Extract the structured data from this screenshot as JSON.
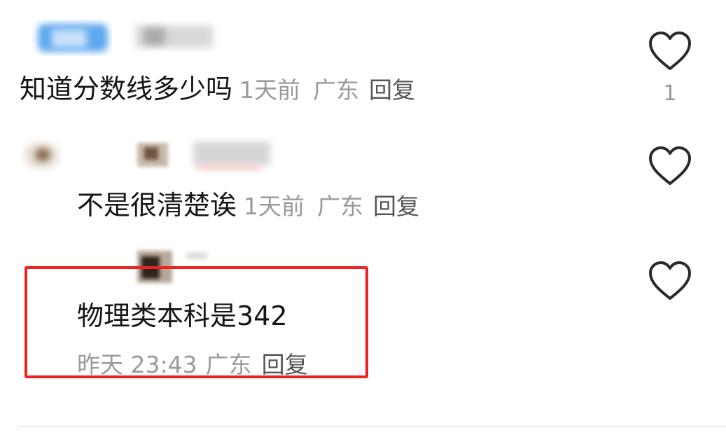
{
  "comments": [
    {
      "text": "知道分数线多少吗",
      "time": "1天前",
      "location": "广东",
      "reply_label": "回复",
      "like_count": "1"
    },
    {
      "text": "不是很清楚诶",
      "time": "1天前",
      "location": "广东",
      "reply_label": "回复",
      "like_count": ""
    },
    {
      "text": "物理类本科是342",
      "time": "昨天 23:43",
      "location": "广东",
      "reply_label": "回复",
      "like_count": ""
    }
  ],
  "icons": {
    "like": "heart-outline-icon"
  },
  "colors": {
    "highlight_border": "#ee2222",
    "meta_text": "#9a9a9a",
    "primary_text": "#151515"
  }
}
